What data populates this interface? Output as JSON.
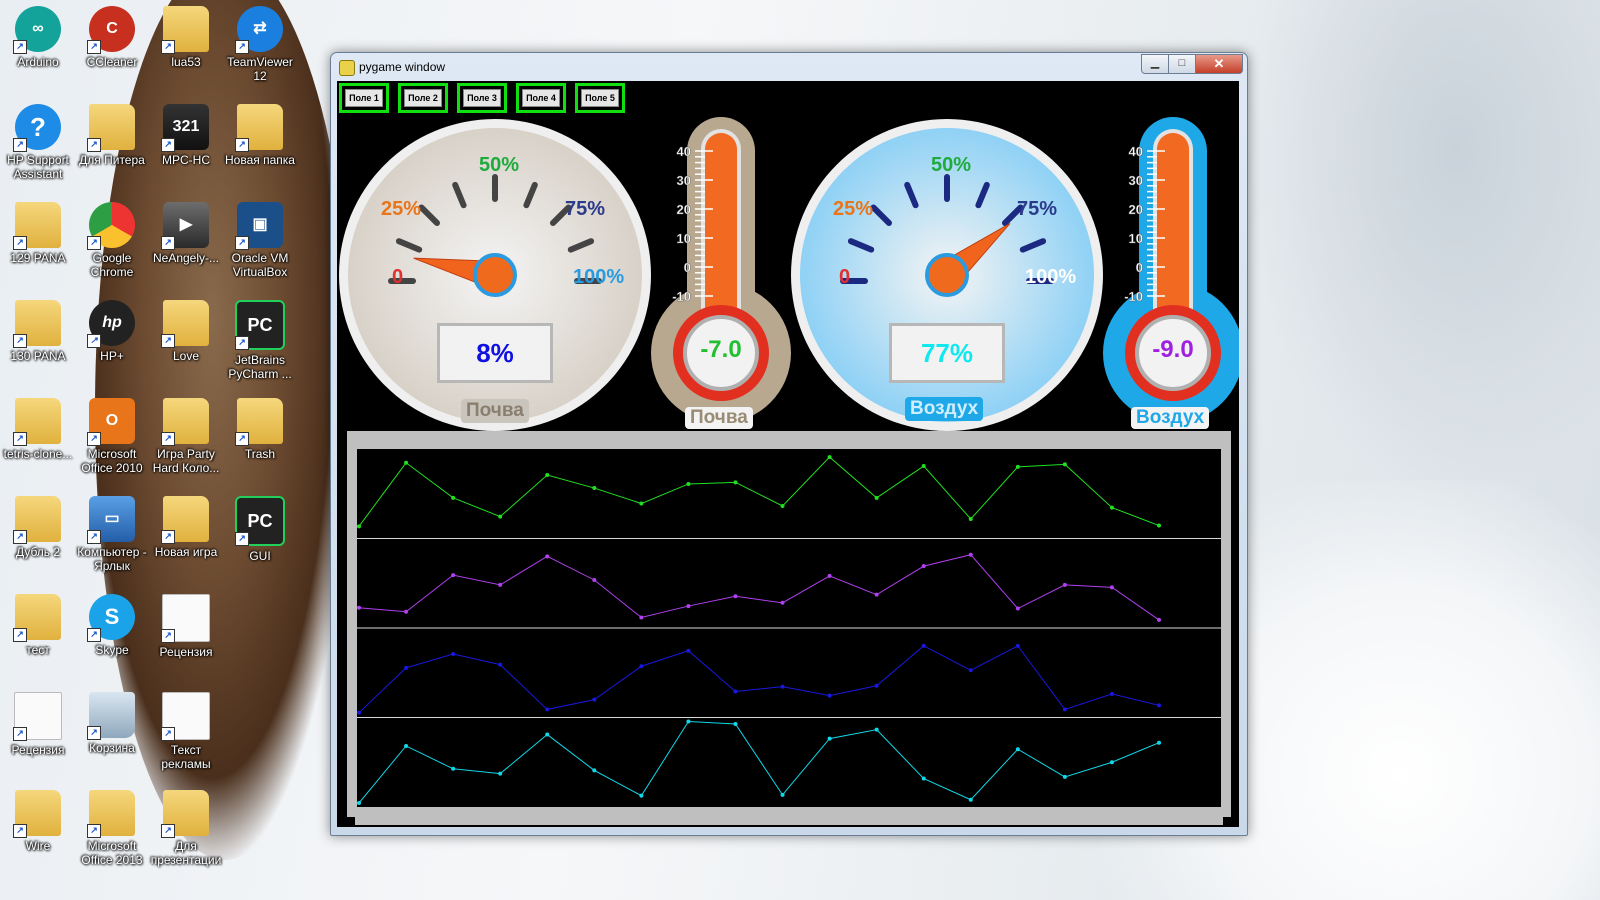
{
  "desktop": {
    "icons": [
      {
        "label": "Arduino",
        "icon": "arduino-icon",
        "glyph": "∞",
        "style": "round-green"
      },
      {
        "label": "CCleaner",
        "icon": "ccleaner-icon",
        "glyph": "C",
        "style": "ccl"
      },
      {
        "label": "lua53",
        "icon": "folder-icon",
        "glyph": "",
        "style": "folder"
      },
      {
        "label": "TeamViewer 12",
        "icon": "teamviewer-icon",
        "glyph": "⇄",
        "style": "round-blue"
      },
      {
        "label": "HP Support Assistant",
        "icon": "help-icon",
        "glyph": "?",
        "style": "help"
      },
      {
        "label": "Для Питера",
        "icon": "folder-icon",
        "glyph": "",
        "style": "folder"
      },
      {
        "label": "MPC-HC",
        "icon": "mpc-icon",
        "glyph": "321",
        "style": "media"
      },
      {
        "label": "Новая папка",
        "icon": "folder-icon",
        "glyph": "",
        "style": "folder"
      },
      {
        "label": "129 PANA",
        "icon": "folder-icon",
        "glyph": "",
        "style": "folder"
      },
      {
        "label": "Google Chrome",
        "icon": "chrome-icon",
        "glyph": "",
        "style": "chrome"
      },
      {
        "label": "NeAngely-...",
        "icon": "video-icon",
        "glyph": "▶",
        "style": "photo"
      },
      {
        "label": "Oracle VM VirtualBox",
        "icon": "virtualbox-icon",
        "glyph": "▣",
        "style": "vbox"
      },
      {
        "label": "130 PANA",
        "icon": "folder-icon",
        "glyph": "",
        "style": "folder"
      },
      {
        "label": "HP+",
        "icon": "hp-icon",
        "glyph": "hp",
        "style": "hp"
      },
      {
        "label": "Love",
        "icon": "folder-icon",
        "glyph": "",
        "style": "folder"
      },
      {
        "label": "JetBrains PyCharm ...",
        "icon": "pycharm-icon",
        "glyph": "PC",
        "style": "pc"
      },
      {
        "label": "tetris-clone...",
        "icon": "folder-icon",
        "glyph": "",
        "style": "folder"
      },
      {
        "label": "Microsoft Office 2010",
        "icon": "office-icon",
        "glyph": "O",
        "style": "office"
      },
      {
        "label": "Игра Party Hard Коло...",
        "icon": "folder-icon",
        "glyph": "",
        "style": "folder"
      },
      {
        "label": "Trash",
        "icon": "folder-icon",
        "glyph": "",
        "style": "folder"
      },
      {
        "label": "Дубль 2",
        "icon": "folder-icon",
        "glyph": "",
        "style": "folder"
      },
      {
        "label": "Компьютер - Ярлык",
        "icon": "computer-icon",
        "glyph": "▭",
        "style": "comp"
      },
      {
        "label": "Новая игра",
        "icon": "folder-icon",
        "glyph": "",
        "style": "folder"
      },
      {
        "label": "GUI",
        "icon": "pycharm-icon",
        "glyph": "PC",
        "style": "pc"
      },
      {
        "label": "тест",
        "icon": "folder-icon",
        "glyph": "",
        "style": "folder"
      },
      {
        "label": "Skype",
        "icon": "skype-icon",
        "glyph": "S",
        "style": "skype"
      },
      {
        "label": "Рецензия",
        "icon": "document-icon",
        "glyph": "",
        "style": "doc"
      },
      {
        "label": "",
        "icon": "",
        "glyph": "",
        "style": ""
      },
      {
        "label": "Рецензия",
        "icon": "document-icon",
        "glyph": "",
        "style": "doc"
      },
      {
        "label": "Корзина",
        "icon": "recycle-bin-icon",
        "glyph": "",
        "style": "bin"
      },
      {
        "label": "Текст рекламы",
        "icon": "document-icon",
        "glyph": "",
        "style": "doc"
      },
      {
        "label": "",
        "icon": "",
        "glyph": "",
        "style": ""
      },
      {
        "label": "Wire",
        "icon": "folder-icon",
        "glyph": "",
        "style": "folder"
      },
      {
        "label": "Microsoft Office 2013",
        "icon": "folder-icon",
        "glyph": "",
        "style": "folder"
      },
      {
        "label": "Для презентации",
        "icon": "folder-icon",
        "glyph": "",
        "style": "folder"
      }
    ]
  },
  "window": {
    "title": "pygame window",
    "minimize": "▁",
    "maximize": "□",
    "close": "✕"
  },
  "tabs": [
    "Поле 1",
    "Поле 2",
    "Поле 3",
    "Поле 4",
    "Поле 5"
  ],
  "gauges": [
    {
      "caption": "Почва",
      "value_text": "8%",
      "value": 8,
      "value_color": "#1010e0",
      "face_color": "#d8d1c8",
      "tick_color": "#444444",
      "labels": {
        "l0": "0",
        "l25": "25%",
        "l50": "50%",
        "l75": "75%",
        "l100": "100%"
      },
      "label_colors": {
        "l0": "#e03030",
        "l25": "#e8751a",
        "l50": "#1faa3c",
        "l75": "#2b3a8a",
        "l100": "#2a9be0"
      }
    },
    {
      "caption": "Воздух",
      "value_text": "77%",
      "value": 77,
      "value_color": "#10e8f0",
      "face_color": "#8fd1f5",
      "tick_color": "#1b2a80",
      "labels": {
        "l0": "0",
        "l25": "25%",
        "l50": "50%",
        "l75": "75%",
        "l100": "100%"
      },
      "label_colors": {
        "l0": "#e03030",
        "l25": "#e8751a",
        "l50": "#1faa3c",
        "l75": "#2b3a8a",
        "l100": "#ffffff"
      }
    }
  ],
  "thermometers": [
    {
      "caption": "Почва",
      "value_text": "-7.0",
      "value": -7.0,
      "value_color": "#20c030",
      "body_color": "#b8a890",
      "scale": [
        "40",
        "30",
        "20",
        "10",
        "0",
        "-10"
      ]
    },
    {
      "caption": "Воздух",
      "value_text": "-9.0",
      "value": -9.0,
      "value_color": "#a020e0",
      "body_color": "#1ea8e8",
      "scale": [
        "40",
        "30",
        "20",
        "10",
        "0",
        "-10"
      ]
    }
  ],
  "chart_data": {
    "type": "line",
    "title": "",
    "x": [
      0,
      1,
      2,
      3,
      4,
      5,
      6,
      7,
      8,
      9,
      10,
      11,
      12,
      13,
      14,
      15,
      16,
      17
    ],
    "series": [
      {
        "color": "#20e020",
        "values": [
          10,
          88,
          45,
          22,
          73,
          57,
          38,
          62,
          64,
          35,
          95,
          45,
          84,
          19,
          83,
          86,
          33,
          11
        ]
      },
      {
        "color": "#b040f0",
        "values": [
          20,
          15,
          60,
          48,
          83,
          54,
          8,
          22,
          34,
          26,
          59,
          36,
          71,
          85,
          19,
          48,
          45,
          5
        ]
      },
      {
        "color": "#1818e0",
        "values": [
          1,
          56,
          73,
          60,
          5,
          17,
          58,
          77,
          27,
          33,
          22,
          34,
          83,
          53,
          83,
          5,
          24,
          10
        ]
      },
      {
        "color": "#10d8e8",
        "values": [
          0,
          70,
          42,
          36,
          84,
          40,
          9,
          100,
          97,
          10,
          79,
          90,
          30,
          4,
          66,
          32,
          50,
          74
        ]
      }
    ],
    "ylim": [
      0,
      100
    ]
  }
}
